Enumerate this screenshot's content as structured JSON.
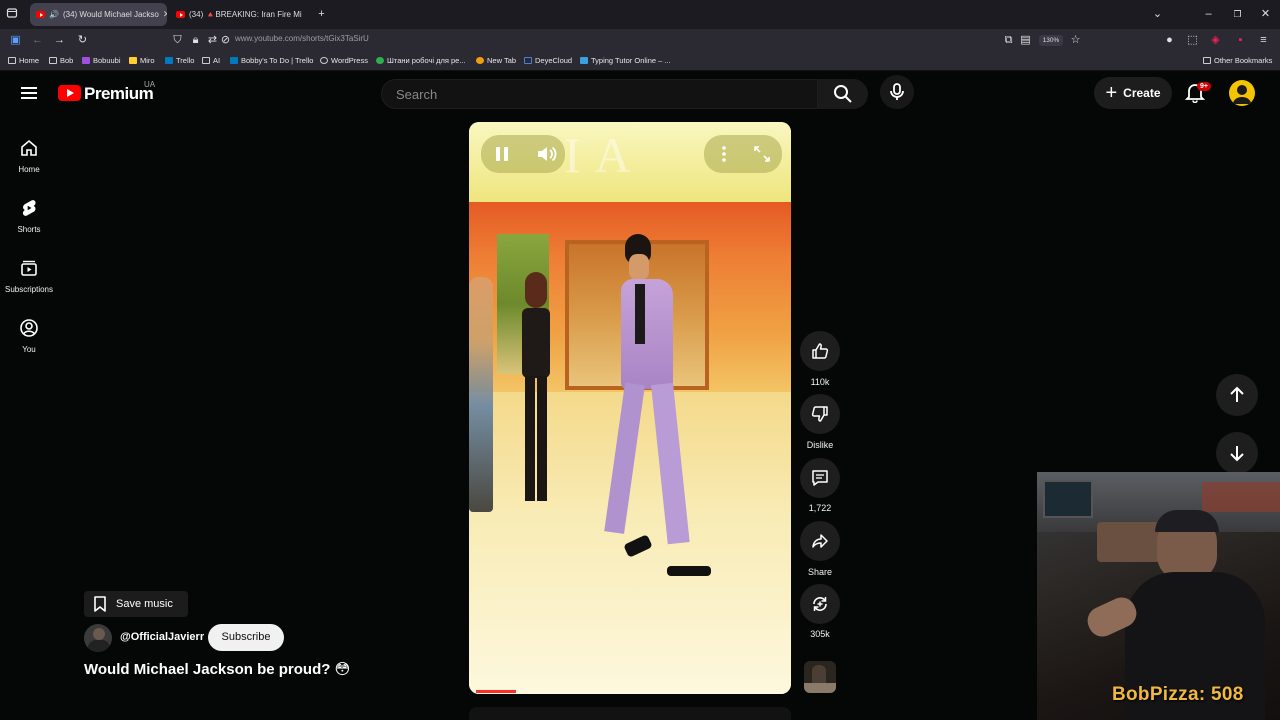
{
  "browser": {
    "tabs": [
      {
        "label": "(34) Would Michael Jackso",
        "active": true
      },
      {
        "label": "(34) 🔺BREAKING: Iran Fire Mi",
        "active": false
      }
    ],
    "url": "www.youtube.com/shorts/tGix3TaSirU",
    "zoom": "130%",
    "bookmarks": [
      "Home",
      "Bob",
      "Bobuubi",
      "Miro",
      "Trello",
      "AI",
      "Bobby's To Do | Trello",
      "WordPress",
      "Штани робочі для ре...",
      "New Tab",
      "DeyeCloud",
      "Typing Tutor Online – ..."
    ],
    "other_bookmarks": "Other Bookmarks"
  },
  "masthead": {
    "logo_text": "Premium",
    "region": "UA",
    "search_placeholder": "Search",
    "create_label": "Create",
    "notification_count": "9+"
  },
  "sidebar": {
    "items": [
      {
        "label": "Home",
        "icon": "home-icon"
      },
      {
        "label": "Shorts",
        "icon": "shorts-icon"
      },
      {
        "label": "Subscriptions",
        "icon": "subscriptions-icon"
      },
      {
        "label": "You",
        "icon": "you-icon"
      }
    ]
  },
  "short": {
    "overlay_watermark": "IA",
    "actions": {
      "like_count": "110k",
      "dislike_label": "Dislike",
      "comment_count": "1,722",
      "share_label": "Share",
      "remix_count": "305k"
    },
    "save_music_label": "Save music",
    "channel": "@OfficialJavierr",
    "subscribe_label": "Subscribe",
    "title": "Would Michael Jackson be proud? 😳"
  },
  "stream_overlay": {
    "text": "BobPizza: 508"
  },
  "colors": {
    "yt_red": "#ff0000",
    "background": "#0f0f0f",
    "overlay_text": "#f0b840"
  }
}
